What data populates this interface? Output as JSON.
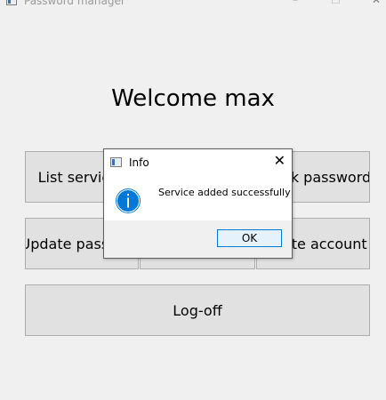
{
  "window": {
    "title": "Password manager",
    "minimize_glyph": "–",
    "maximize_glyph": "☐",
    "close_glyph": "✕"
  },
  "main": {
    "welcome_text": "Welcome max",
    "buttons": {
      "list_services": "List services",
      "check_password": "Check password",
      "update_password": "Update password",
      "add_service": "",
      "delete_account": "Delete account",
      "log_off": "Log-off"
    }
  },
  "dialog": {
    "title": "Info",
    "close_glyph": "✕",
    "message": "Service added successfully",
    "ok_label": "OK",
    "icon": "info-icon",
    "accent_color": "#0078d7"
  }
}
